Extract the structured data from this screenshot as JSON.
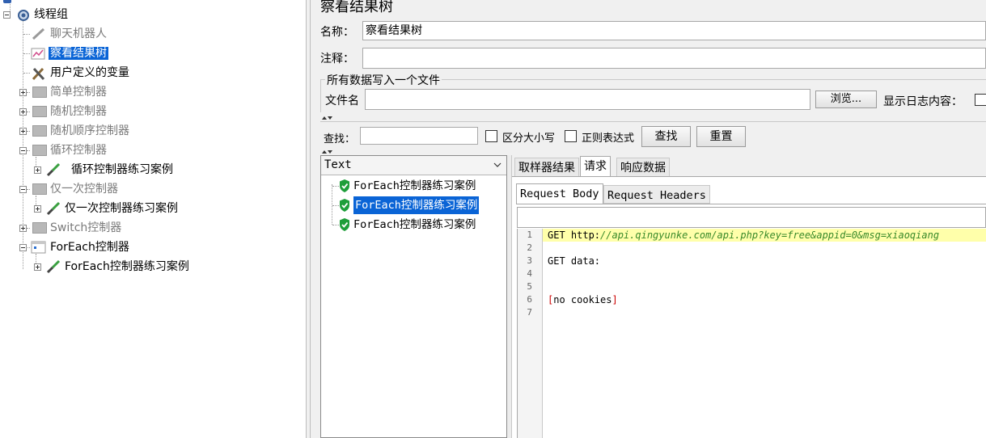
{
  "tree": {
    "root": "线程组",
    "items": [
      {
        "label": "聊天机器人"
      },
      {
        "label": "察看结果树"
      },
      {
        "label": "用户定义的变量"
      },
      {
        "label": "简单控制器"
      },
      {
        "label": "随机控制器"
      },
      {
        "label": "随机顺序控制器"
      },
      {
        "label": "循环控制器"
      },
      {
        "label": "循环控制器练习案例"
      },
      {
        "label": "仅一次控制器"
      },
      {
        "label": "仅一次控制器练习案例"
      },
      {
        "label": "Switch控制器"
      },
      {
        "label": "ForEach控制器"
      },
      {
        "label": "ForEach控制器练习案例"
      }
    ]
  },
  "panel": {
    "title": "察看结果树",
    "name_label": "名称：",
    "name_value": "察看结果树",
    "comment_label": "注释：",
    "comment_value": "",
    "file_section_title": "所有数据写入一个文件",
    "filename_label": "文件名",
    "filename_value": "",
    "browse_label": "浏览...",
    "log_label": "显示日志内容："
  },
  "search": {
    "label": "查找：",
    "value": "",
    "case_label": "区分大小写",
    "regex_label": "正则表达式",
    "find_button": "查找",
    "reset_button": "重置"
  },
  "results": {
    "renderer": "Text",
    "samples": [
      {
        "label": "ForEach控制器练习案例",
        "status": "success"
      },
      {
        "label": "ForEach控制器练习案例",
        "status": "success"
      },
      {
        "label": "ForEach控制器练习案例",
        "status": "success"
      }
    ]
  },
  "tabs": {
    "main": [
      "取样器结果",
      "请求",
      "响应数据"
    ],
    "active_main": "请求",
    "sub": [
      "Request Body",
      "Request Headers"
    ],
    "active_sub": "Request Body"
  },
  "editor": {
    "lines": [
      {
        "num": "1",
        "parts": [
          {
            "t": "GET http:",
            "c": "plain"
          },
          {
            "t": "//api.qingyunke.com/api.php?key=free&appid=0&msg=xiaoqiang",
            "c": "comment"
          }
        ]
      },
      {
        "num": "2",
        "parts": []
      },
      {
        "num": "3",
        "parts": [
          {
            "t": "GET data:",
            "c": "plain"
          }
        ]
      },
      {
        "num": "4",
        "parts": []
      },
      {
        "num": "5",
        "parts": []
      },
      {
        "num": "6",
        "parts": [
          {
            "t": "[",
            "c": "bracket"
          },
          {
            "t": "no cookies",
            "c": "plain"
          },
          {
            "t": "]",
            "c": "bracket"
          }
        ]
      },
      {
        "num": "7",
        "parts": []
      }
    ]
  },
  "colors": {
    "selection": "#0a64d6",
    "highlight_line": "#ffffaa",
    "success": "#1e9e3a",
    "comment_text": "#3a8a2a",
    "bracket": "#cc0000"
  }
}
